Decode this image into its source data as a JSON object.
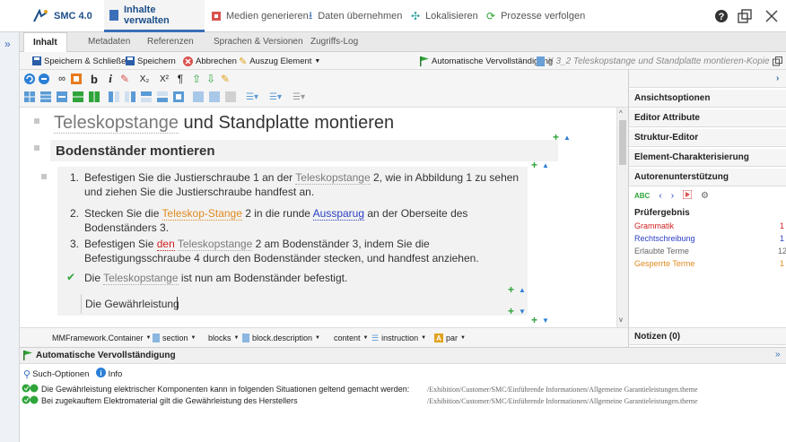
{
  "app": {
    "name": "SMC 4.0"
  },
  "top_tabs": [
    {
      "label": "Inhalte verwalten"
    },
    {
      "label": "Medien generieren"
    },
    {
      "label": "Daten übernehmen"
    },
    {
      "label": "Lokalisieren"
    },
    {
      "label": "Prozesse verfolgen"
    }
  ],
  "sub_tabs": [
    {
      "label": "Inhalt"
    },
    {
      "label": "Metadaten"
    },
    {
      "label": "Referenzen"
    },
    {
      "label": "Sprachen & Versionen"
    },
    {
      "label": "Zugriffs-Log"
    }
  ],
  "actions": {
    "save_close": "Speichern & Schließen",
    "save": "Speichern",
    "cancel": "Abbrechen",
    "excerpt": "Auszug Element",
    "autocomplete": "Automatische Vervollständigung",
    "document_title": "X 3_2 Teleskopstange und Standplatte montieren-Kopie"
  },
  "format_toolbar": {
    "bold": "b",
    "italic": "i",
    "subscript": "X₂",
    "superscript": "X²",
    "pilcrow": "¶"
  },
  "editor": {
    "title_term": "Teleskopstange",
    "title_rest": " und Standplatte montieren",
    "subtitle": "Bodenständer montieren",
    "step1_n": "1.",
    "step1_a": "Befestigen Sie die Justierschraube 1 an der ",
    "step1_term": "Teleskopstange",
    "step1_b": " 2, wie in Abbildung 1 zu sehen",
    "step1_c": "und ziehen Sie die Justierschraube handfest an.",
    "step2_n": "2.",
    "step2_a": "Stecken Sie die ",
    "step2_term": "Teleskop-Stange",
    "step2_b": " 2 in die runde ",
    "step2_term2": "Aussparug",
    "step2_c": " an der Oberseite des",
    "step2_d": "Bodenständers 3.",
    "step3_n": "3.",
    "step3_a": "Befestigen Sie ",
    "step3_term_red": "den",
    "step3_b": " ",
    "step3_term": "Teleskopstange",
    "step3_c": " 2 am Bodenständer 3, indem Sie die",
    "step3_d": "Befestigungsschraube 4 durch den Bodenständer stecken, und handfest anziehen.",
    "result_a": "Die ",
    "result_term": "Teleskopstange",
    "result_b": " ist nun am Bodenständer befestigt.",
    "input_text": "Die Gewährleistung"
  },
  "breadcrumb": [
    {
      "label": "MMFramework.Container"
    },
    {
      "label": "section"
    },
    {
      "label": "blocks"
    },
    {
      "label": "block.description"
    },
    {
      "label": "content"
    },
    {
      "label": "instruction"
    },
    {
      "label": "par"
    }
  ],
  "right_panel": {
    "view_options": "Ansichtsoptionen",
    "editor_attributes": "Editor Attribute",
    "structure_editor": "Struktur-Editor",
    "element_char": "Element-Charakterisierung",
    "author_support": "Autorenunterstützung",
    "check_result": "Prüfergebnis",
    "grammar": "Grammatik",
    "spelling": "Rechtschreibung",
    "allowed_terms": "Erlaubte Terme",
    "blocked_terms": "Gesperrte Terme",
    "grammar_count": "1",
    "spelling_count": "1",
    "allowed_count": "12",
    "blocked_count": "1",
    "notes": "Notizen (0)"
  },
  "bottom_panel": {
    "title": "Automatische Vervollständigung",
    "search_options": "Such-Optionen",
    "info": "Info",
    "results": [
      {
        "text": "Die Gewährleistung elektrischer Komponenten kann in folgenden Situationen geltend gemacht werden:",
        "path": "/Exhibition/Customer/SMC/Einführende Informationen/Allgemeine Garantieleistungen.theme"
      },
      {
        "text": "Bei zugekauftem Elektromaterial gilt die Gewährleistung des Herstellers",
        "path": "/Exhibition/Customer/SMC/Einführende Informationen/Allgemeine Garantieleistungen.theme"
      }
    ]
  },
  "colors": {
    "accent": "#3a6fb7",
    "green": "#2fa43a",
    "red": "#d02020",
    "orange": "#e08a1e"
  }
}
